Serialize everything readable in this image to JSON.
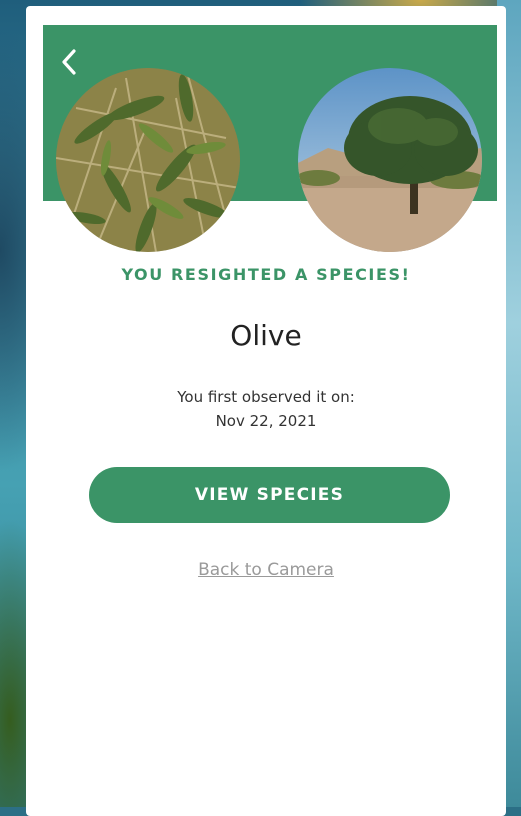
{
  "screen": {
    "headline": "YOU RESIGHTED A SPECIES!",
    "species_name": "Olive",
    "observed_label": "You first observed it on:",
    "observed_date": "Nov 22, 2021",
    "view_button_label": "VIEW SPECIES",
    "back_link_label": "Back to Camera"
  },
  "icons": {
    "back": "chevron-left-icon"
  },
  "colors": {
    "brand_green": "#3b9467",
    "background": "#ffffff",
    "link_gray": "#9a9a9a"
  }
}
